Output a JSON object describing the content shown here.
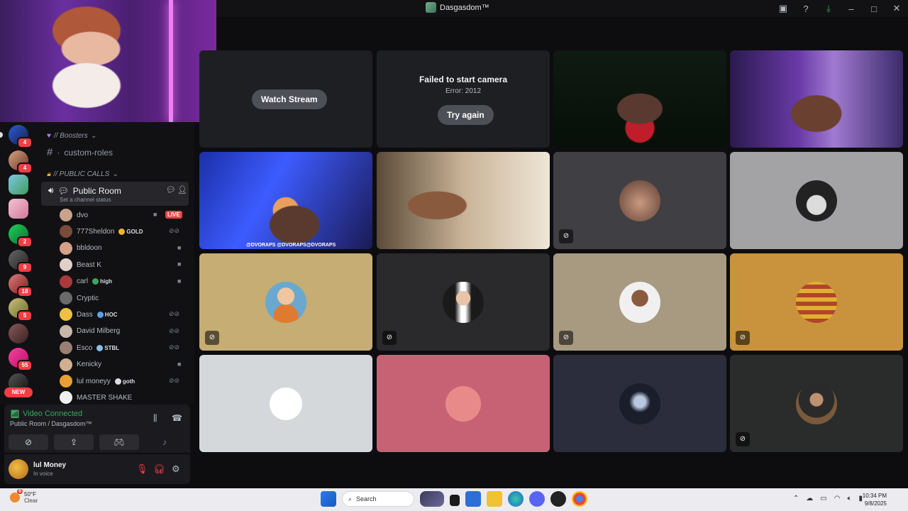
{
  "window": {
    "title": "Dasgasdom™"
  },
  "sidebar": {
    "categories": {
      "boosters": "// Boosters",
      "public_calls": "// PUBLIC CALLS"
    },
    "text_channel": "custom-roles",
    "voice_channel": {
      "name": "Public Room",
      "status_placeholder": "Set a channel status"
    },
    "members": [
      {
        "name": "dvo",
        "badge": "",
        "right": "LIVE"
      },
      {
        "name": "777Sheldon",
        "badge": "GOLD",
        "right": "muted"
      },
      {
        "name": "bbldoon",
        "badge": "",
        "right": "camera"
      },
      {
        "name": "Beast K",
        "badge": "",
        "right": "camera"
      },
      {
        "name": "carl",
        "badge": "high",
        "right": "camera"
      },
      {
        "name": "Cryptic",
        "badge": "",
        "right": ""
      },
      {
        "name": "Dass",
        "badge": "HOC",
        "right": "muted"
      },
      {
        "name": "David Milberg",
        "badge": "",
        "right": "muted"
      },
      {
        "name": "Esco",
        "badge": "STBL",
        "right": "muted"
      },
      {
        "name": "Kenicky",
        "badge": "",
        "right": "camera"
      },
      {
        "name": "lul moneyy",
        "badge": "goth",
        "right": "muted"
      },
      {
        "name": "MASTER SHAKE",
        "badge": "",
        "right": ""
      }
    ],
    "server_badges": [
      "4",
      "4",
      "2",
      "9",
      "18",
      "5",
      "55"
    ],
    "new_label": "NEW"
  },
  "voice_panel": {
    "status": "Video Connected",
    "room": "Public Room / Dasgasdom™"
  },
  "user_panel": {
    "name": "lul Money",
    "status": "In voice"
  },
  "grid": {
    "watch_stream": "Watch Stream",
    "camera_error_title": "Failed to start camera",
    "camera_error_code": "Error: 2012",
    "try_again": "Try again",
    "stream_watermark": "@DVORAPS @DVORAPS@DVORAPS"
  },
  "taskbar": {
    "weather_temp": "50°F",
    "weather_desc": "Clear",
    "weather_alert": "6",
    "search_label": "Search",
    "time": "10:34 PM",
    "date": "9/8/2025"
  },
  "colors": {
    "accent_green": "#3ba55d",
    "live_red": "#f23f43"
  }
}
